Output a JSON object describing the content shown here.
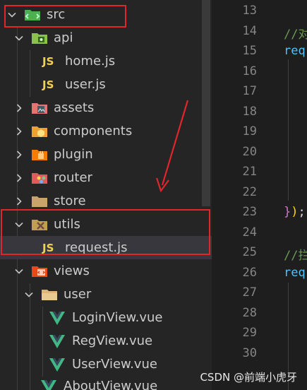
{
  "explorer": {
    "items": [
      {
        "label": "src",
        "icon": "folder-src-icon",
        "expanded": true
      },
      {
        "label": "api",
        "icon": "folder-api-icon",
        "expanded": true
      },
      {
        "label": "home.js",
        "icon": "js-file-icon"
      },
      {
        "label": "user.js",
        "icon": "js-file-icon"
      },
      {
        "label": "assets",
        "icon": "folder-assets-icon",
        "expanded": false
      },
      {
        "label": "components",
        "icon": "folder-components-icon",
        "expanded": false
      },
      {
        "label": "plugin",
        "icon": "folder-plugin-icon",
        "expanded": false
      },
      {
        "label": "router",
        "icon": "folder-router-icon",
        "expanded": false
      },
      {
        "label": "store",
        "icon": "folder-store-icon",
        "expanded": false
      },
      {
        "label": "utils",
        "icon": "folder-utils-icon",
        "expanded": true
      },
      {
        "label": "request.js",
        "icon": "js-file-icon",
        "selected": true
      },
      {
        "label": "views",
        "icon": "folder-views-icon",
        "expanded": true
      },
      {
        "label": "user",
        "icon": "folder-icon",
        "expanded": true
      },
      {
        "label": "LoginView.vue",
        "icon": "vue-file-icon"
      },
      {
        "label": "RegView.vue",
        "icon": "vue-file-icon"
      },
      {
        "label": "UserView.vue",
        "icon": "vue-file-icon"
      },
      {
        "label": "AboutView.vue",
        "icon": "vue-file-icon"
      }
    ],
    "js_badge": "JS"
  },
  "editor": {
    "line_numbers": [
      "13",
      "14",
      "15",
      "16",
      "17",
      "18",
      "19",
      "20",
      "21",
      "22",
      "23",
      "24",
      "25",
      "26",
      "27",
      "28",
      "29",
      "30"
    ],
    "code": {
      "line14": "//对",
      "line15": "req",
      "line23_brace": "}",
      "line23_paren": ")",
      "line23_semi": ";",
      "line25": "//拦",
      "line26": "req"
    }
  },
  "watermark": "CSDN @前端小虎牙",
  "colors": {
    "annotation_red": "#e0262b",
    "js_yellow": "#f1d14f",
    "vue_green": "#41b883",
    "comment_green": "#6a9955",
    "identifier_blue": "#4fc1ff"
  }
}
